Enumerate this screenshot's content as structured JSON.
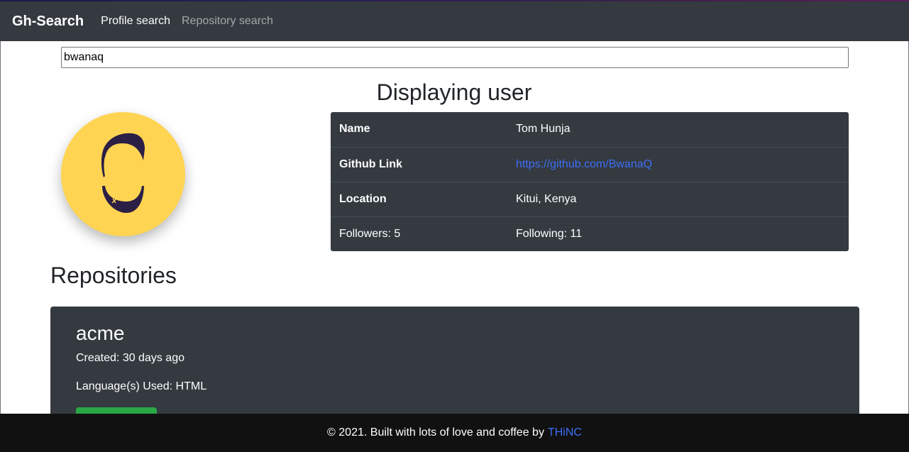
{
  "navbar": {
    "brand": "Gh-Search",
    "links": [
      {
        "label": "Profile search",
        "active": true
      },
      {
        "label": "Repository search",
        "active": false
      }
    ]
  },
  "search": {
    "value": "bwanaq",
    "placeholder": ""
  },
  "profile": {
    "heading": "Displaying user",
    "rows": [
      {
        "key": "Name",
        "value": "Tom Hunja"
      },
      {
        "key": "Github Link",
        "value": "https://github.com/BwanaQ"
      },
      {
        "key": "Location",
        "value": "Kitui, Kenya"
      }
    ],
    "followers": "Followers: 5",
    "following": "Following: 11"
  },
  "repositories": {
    "heading": "Repositories",
    "items": [
      {
        "name": "acme",
        "created": "Created: 30 days ago",
        "languages": "Language(s) Used: HTML"
      }
    ]
  },
  "footer": {
    "text": "© 2021. Built with lots of love and coffee by",
    "link_label": "THiNC"
  },
  "colors": {
    "navbar": "#343a40",
    "avatar_bg": "#fed452",
    "link": "#3d6ef5",
    "button": "#28a745",
    "footer": "#111111"
  },
  "icons": {
    "avatar": "cartoon-face-avatar"
  }
}
